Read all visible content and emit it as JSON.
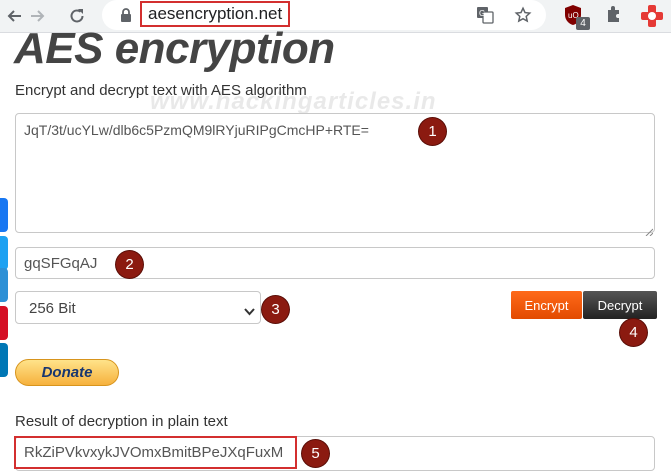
{
  "browser": {
    "url": "aesencryption.net",
    "extension_badge": "4",
    "icons": [
      "back-icon",
      "forward-icon",
      "reload-icon",
      "lock-icon",
      "translate-icon",
      "star-icon",
      "ublock-icon",
      "puzzle-icon",
      "profile-extension-icon"
    ]
  },
  "page": {
    "title": "AES encryption",
    "subtitle": "Encrypt and decrypt text with AES algorithm",
    "watermark": "www.hackingarticles.in",
    "text_input": "JqT/3t/ucYLw/dlb6c5PzmQM9lRYjuRIPgCmcHP+RTE=",
    "key_input": "gqSFGqAJ",
    "key_size": "256 Bit",
    "encrypt_label": "Encrypt",
    "decrypt_label": "Decrypt",
    "donate_label": "Donate",
    "result_label": "Result of decryption in plain text",
    "result_value": "RkZiPVkvxykJVOmxBmitBPeJXqFuxM"
  },
  "markers": [
    "1",
    "2",
    "3",
    "4",
    "5"
  ],
  "colors": {
    "encrypt": "#ff5f14",
    "decrypt": "#333333",
    "highlight": "#d32f2f",
    "marker": "#8b1a10"
  }
}
